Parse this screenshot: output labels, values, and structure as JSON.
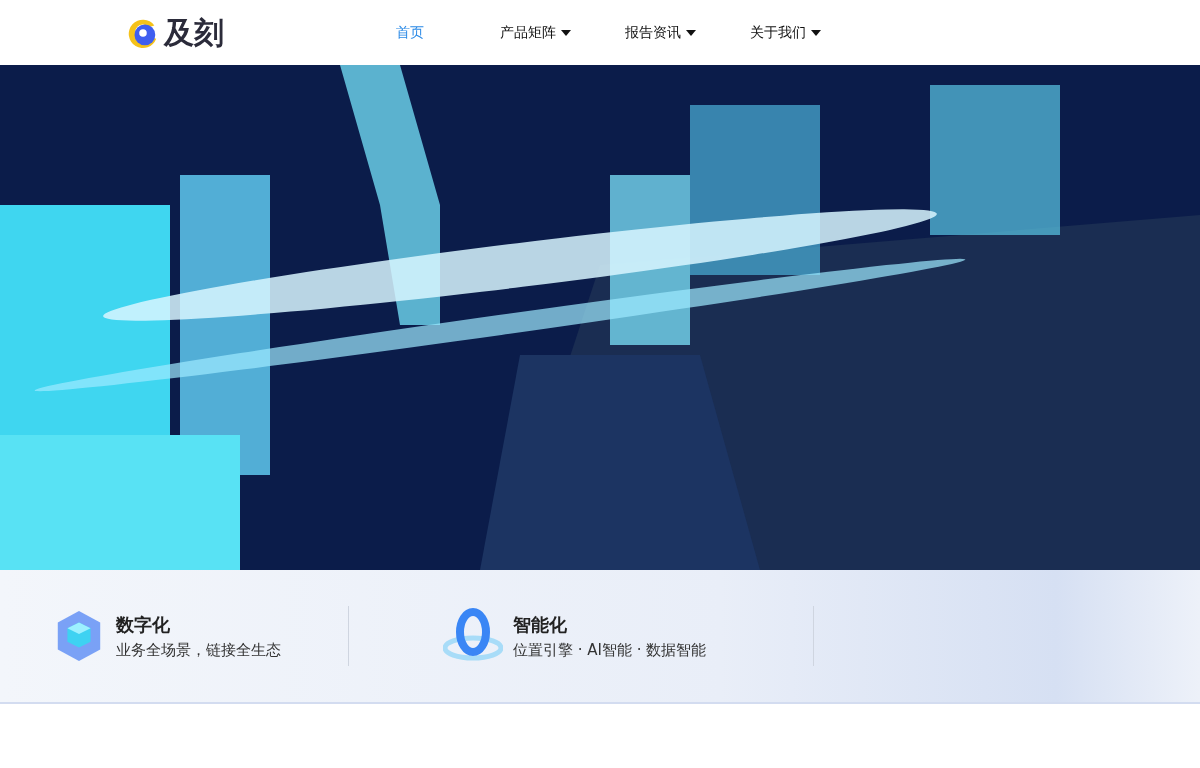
{
  "header": {
    "logo_text": "及刻",
    "nav": [
      {
        "label": "首页",
        "selected": true,
        "has_menu": false
      },
      {
        "label": "产品矩阵",
        "selected": false,
        "has_menu": true
      },
      {
        "label": "报告资讯",
        "selected": false,
        "has_menu": true
      },
      {
        "label": "关于我们",
        "selected": false,
        "has_menu": true
      }
    ]
  },
  "features": [
    {
      "kind": "cube",
      "title": "数字化",
      "subtitle": "业务全场景，链接全生态"
    },
    {
      "kind": "ring",
      "title": "智能化",
      "subtitle": "位置引擎 · AI智能 · 数据智能"
    }
  ]
}
